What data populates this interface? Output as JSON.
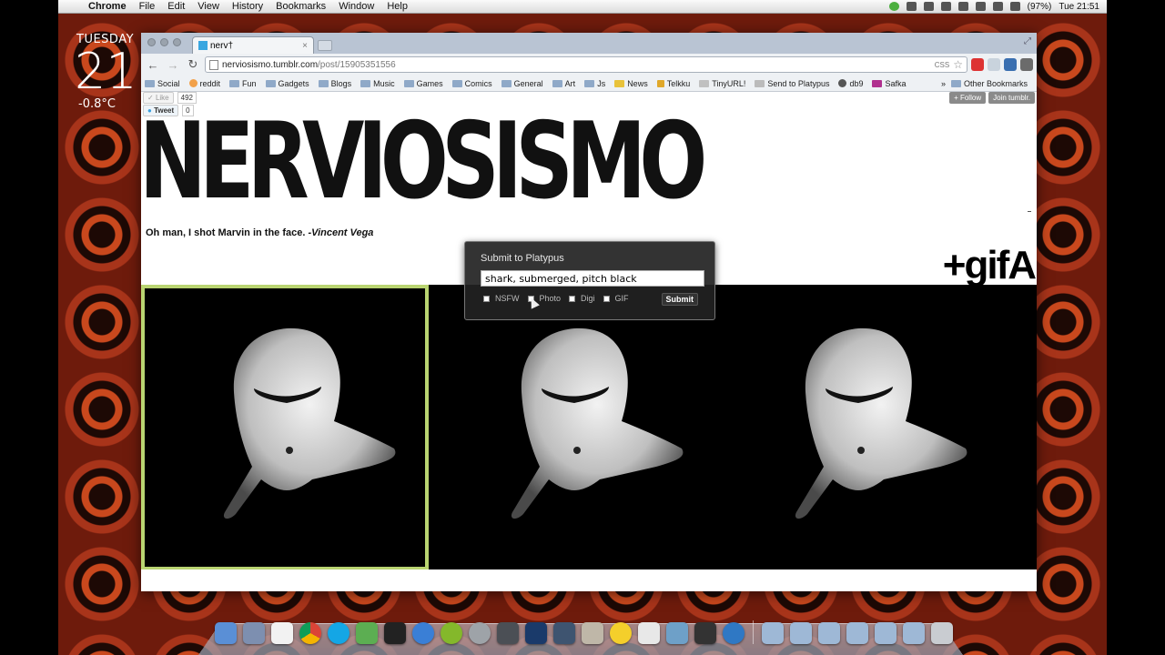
{
  "menubar": {
    "app_name": "Chrome",
    "menus": [
      "File",
      "Edit",
      "View",
      "History",
      "Bookmarks",
      "Window",
      "Help"
    ],
    "battery": "(97%)",
    "clock": "Tue 21:51"
  },
  "widget": {
    "day": "TUESDAY",
    "date": "21",
    "temp": "-0.8°C"
  },
  "browser": {
    "tab_title": "nerv†",
    "url": "nerviosismo.tumblr.com/post/15905351556",
    "url_host": "nerviosismo.tumblr.com",
    "url_path": "/post/15905351556",
    "css_label": "CSS",
    "bookmarks": [
      {
        "label": "Social",
        "icon": "folder-icon"
      },
      {
        "label": "reddit",
        "icon": "reddit-icon"
      },
      {
        "label": "Fun",
        "icon": "folder-icon"
      },
      {
        "label": "Gadgets",
        "icon": "folder-icon"
      },
      {
        "label": "Blogs",
        "icon": "folder-icon"
      },
      {
        "label": "Music",
        "icon": "folder-icon"
      },
      {
        "label": "Games",
        "icon": "folder-icon"
      },
      {
        "label": "Comics",
        "icon": "folder-icon"
      },
      {
        "label": "General",
        "icon": "folder-icon"
      },
      {
        "label": "Art",
        "icon": "folder-icon"
      },
      {
        "label": "Js",
        "icon": "folder-icon"
      },
      {
        "label": "News",
        "icon": "news-icon"
      },
      {
        "label": "Telkku",
        "icon": "telkku-icon"
      },
      {
        "label": "TinyURL!",
        "icon": "tinyurl-icon"
      },
      {
        "label": "Send to Platypus",
        "icon": "link-icon"
      },
      {
        "label": "db9",
        "icon": "db9-icon"
      },
      {
        "label": "Safka",
        "icon": "safka-icon"
      }
    ],
    "bookmarks_overflow": "»",
    "other_bookmarks": "Other Bookmarks"
  },
  "page": {
    "like_label": "Like",
    "like_count": "492",
    "tweet_label": "Tweet",
    "tweet_count": "0",
    "follow_label": "+ Follow",
    "join_label": "Join tumblr.",
    "site_title": "NERVIOSISMO",
    "quote_text": "Oh man, I shot Marvin in the face. ",
    "quote_author": "-Vincent Vega",
    "gifa_label": "+gifA"
  },
  "platypus": {
    "title": "Submit to Platypus",
    "tags_value": "shark, submerged, pitch black",
    "options": [
      "NSFW",
      "Photo",
      "Digi",
      "GIF"
    ],
    "submit_label": "Submit"
  },
  "colors": {
    "selection_border": "#b9d471",
    "popup_bg": "#222222"
  }
}
